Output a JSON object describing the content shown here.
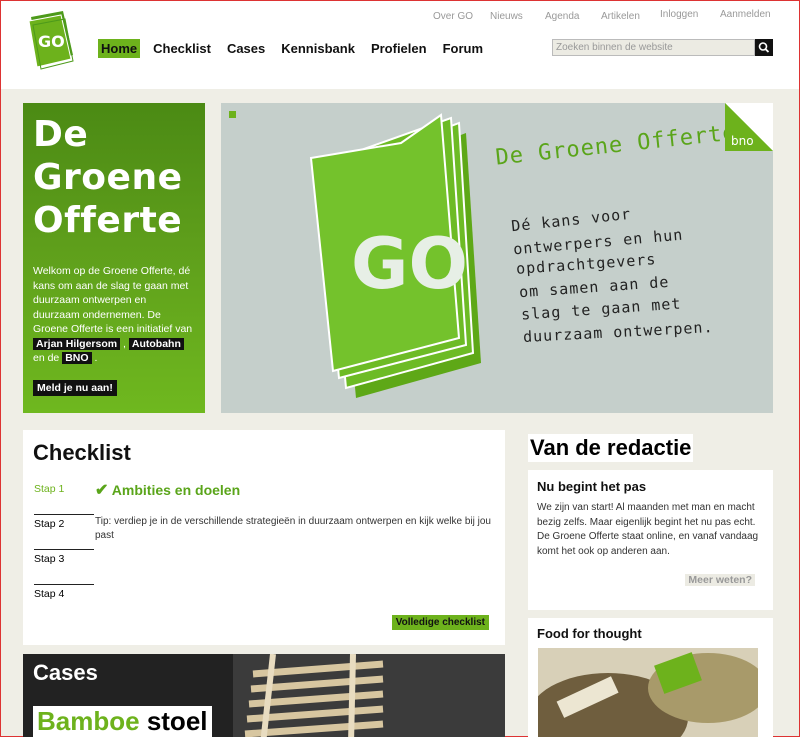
{
  "header": {
    "top_links": [
      "Over GO",
      "Nieuws",
      "Agenda",
      "Artikelen",
      "Inloggen",
      "Aanmelden"
    ],
    "nav": [
      "Home",
      "Checklist",
      "Cases",
      "Kennisbank",
      "Profielen",
      "Forum"
    ],
    "nav_active": "Home",
    "search_placeholder": "Zoeken binnen de website",
    "logo_text": "GO"
  },
  "intro": {
    "title_lines": [
      "De",
      "Groene",
      "Offerte"
    ],
    "text_1": "Welkom op de Groene Offerte, dé kans om aan de slag te gaan met duurzaam ontwerpen en duurzaam ondernemen. De Groene Offerte is een initiatief van",
    "link_1": "Arjan Hilgersom",
    "link_2": "Autobahn",
    "text_2": "en de",
    "link_3": "BNO",
    "cta": "Meld je nu aan!"
  },
  "banner": {
    "title": "De Groene Offerte",
    "lines": [
      "Dé kans voor",
      "ontwerpers en hun",
      "opdrachtgevers",
      "om samen aan de",
      "slag te gaan met",
      "duurzaam ontwerpen."
    ],
    "badge": "bno",
    "logo_text": "GO"
  },
  "checklist": {
    "title": "Checklist",
    "steps": [
      "Stap 1",
      "Stap 2",
      "Stap 3",
      "Stap 4"
    ],
    "current_heading": "Ambities en doelen",
    "tip": "Tip: verdiep je in de verschillende strategieën in duurzaam ontwerpen en kijk welke bij jou past",
    "full_link": "Volledige checklist"
  },
  "cases": {
    "title": "Cases",
    "name_green": "Bamboe",
    "name_black": "stoel"
  },
  "redactie": {
    "title": "Van de redactie",
    "article_title": "Nu begint het pas",
    "article_text": "We zijn van start! Al maanden met man en macht bezig zelfs. Maar eigenlijk begint het nu pas echt. De Groene Offerte staat online, en vanaf vandaag komt het ook op anderen aan.",
    "more": "Meer weten?",
    "food_title": "Food for thought"
  },
  "colors": {
    "accent": "#6db21c",
    "dark": "#111111",
    "bg": "#efeee6"
  }
}
